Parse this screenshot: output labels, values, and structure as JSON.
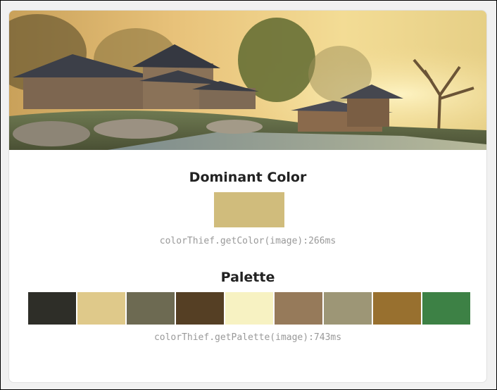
{
  "dominant": {
    "heading": "Dominant Color",
    "color": "#d0bc7c",
    "code": "colorThief.getColor(image):266ms"
  },
  "palette": {
    "heading": "Palette",
    "colors": [
      "#2e2e28",
      "#dfc98a",
      "#6d6a52",
      "#553f24",
      "#f7f2c2",
      "#967a5a",
      "#9d9676",
      "#98702f",
      "#3d8145"
    ],
    "code": "colorThief.getPalette(image):743ms"
  }
}
